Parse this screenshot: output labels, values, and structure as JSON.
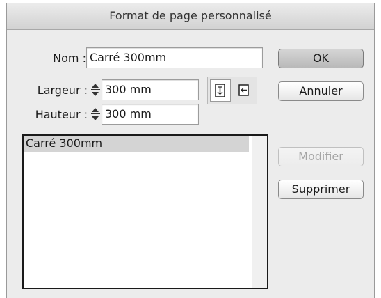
{
  "window": {
    "title": "Format de page personnalisé"
  },
  "form": {
    "name_label": "Nom :",
    "name_value": "Carré 300mm",
    "width_label": "Largeur :",
    "width_value": "300 mm",
    "height_label": "Hauteur :",
    "height_value": "300 mm",
    "orientation": {
      "selected": "portrait",
      "icons": [
        "portrait-orientation-icon",
        "landscape-orientation-icon"
      ]
    }
  },
  "buttons": {
    "ok": "OK",
    "cancel": "Annuler",
    "modify": "Modifier",
    "delete": "Supprimer"
  },
  "presets": {
    "items": [
      {
        "label": "Carré 300mm",
        "selected": true
      }
    ]
  }
}
